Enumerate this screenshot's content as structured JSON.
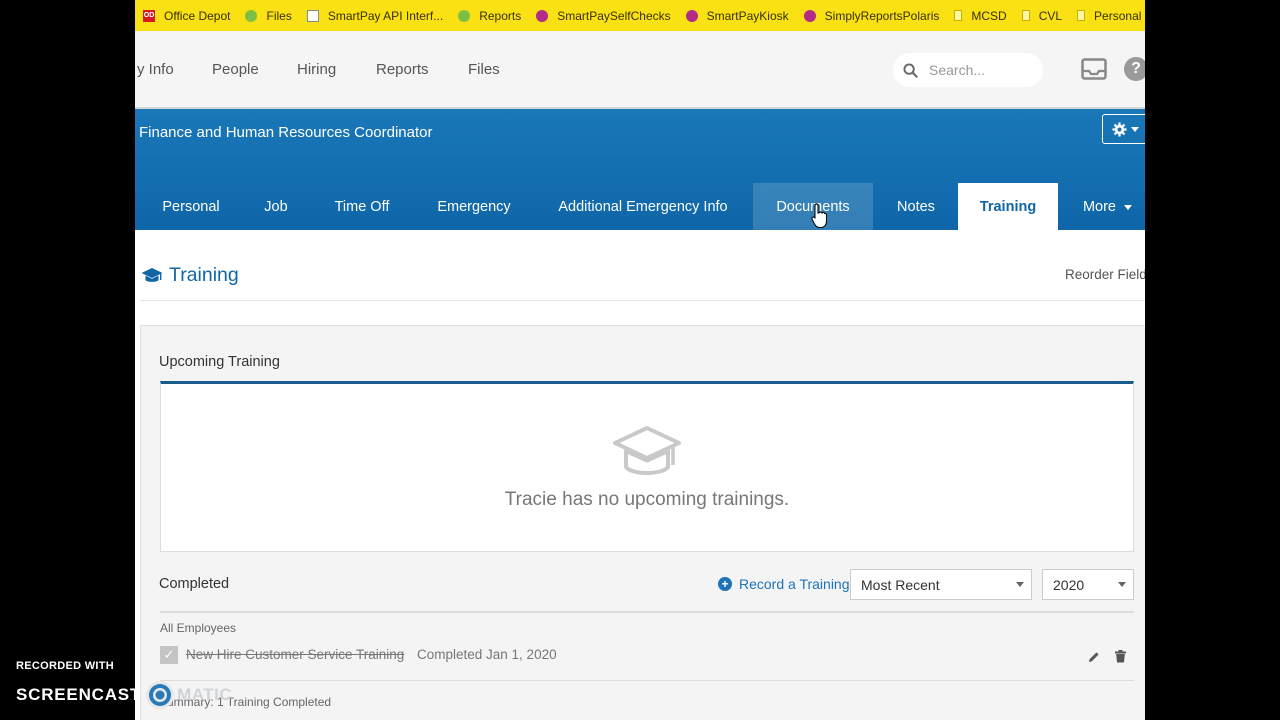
{
  "bookmarks": [
    {
      "label": "Office Depot",
      "icon": "office-depot-icon"
    },
    {
      "label": "Files",
      "icon": "green-circle-icon"
    },
    {
      "label": "SmartPay API Interf...",
      "icon": "document-icon"
    },
    {
      "label": "Reports",
      "icon": "green-circle-icon"
    },
    {
      "label": "SmartPaySelfChecks",
      "icon": "purple-circle-icon"
    },
    {
      "label": "SmartPayKiosk",
      "icon": "purple-circle-icon"
    },
    {
      "label": "SimplyReportsPolaris",
      "icon": "purple-circle-icon"
    },
    {
      "label": "MCSD",
      "icon": "folder-icon"
    },
    {
      "label": "CVL",
      "icon": "folder-icon"
    },
    {
      "label": "Personal",
      "icon": "folder-icon"
    }
  ],
  "topnav": {
    "items": [
      "y Info",
      "People",
      "Hiring",
      "Reports",
      "Files"
    ],
    "search_placeholder": "Search..."
  },
  "employee": {
    "job_title": "Finance and Human Resources Coordinator"
  },
  "tabs": [
    {
      "label": "Personal",
      "state": "normal"
    },
    {
      "label": "Job",
      "state": "normal"
    },
    {
      "label": "Time Off",
      "state": "normal"
    },
    {
      "label": "Emergency",
      "state": "normal"
    },
    {
      "label": "Additional Emergency Info",
      "state": "normal"
    },
    {
      "label": "Documents",
      "state": "hover"
    },
    {
      "label": "Notes",
      "state": "normal"
    },
    {
      "label": "Training",
      "state": "active"
    },
    {
      "label": "More",
      "state": "dropdown"
    }
  ],
  "section": {
    "title": "Training",
    "reorder_label": "Reorder Field"
  },
  "upcoming": {
    "label": "Upcoming Training",
    "empty_message": "Tracie has no upcoming trainings."
  },
  "completed": {
    "label": "Completed",
    "record_label": "Record a Training",
    "sort_value": "Most Recent",
    "year_value": "2020",
    "group_label": "All Employees",
    "items": [
      {
        "name": "New Hire Customer Service Training",
        "status": "Completed Jan 1, 2020",
        "checked": true
      }
    ],
    "summary": "Summary: 1 Training Completed"
  },
  "watermark": {
    "recorded": "RECORDED WITH",
    "brand_left": "SCREENCAST",
    "brand_right": "MATIC"
  },
  "colors": {
    "bookmark_bar": "#f9e113",
    "header_blue": "#1471b4",
    "accent": "#1167a5"
  }
}
